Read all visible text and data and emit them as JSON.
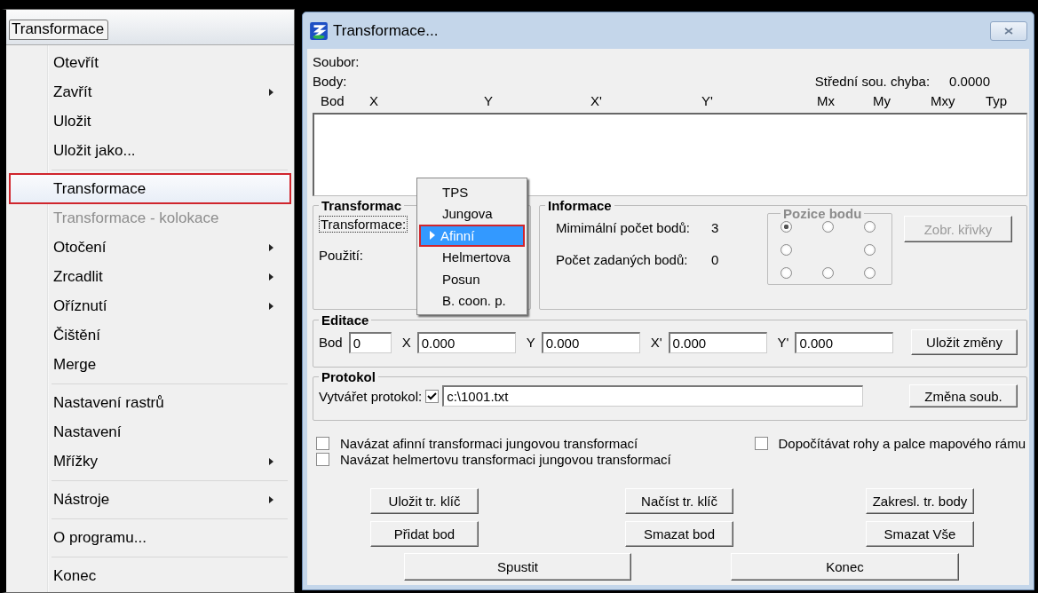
{
  "menu_bar": {
    "title": "Transformace"
  },
  "menu": {
    "groups": [
      [
        {
          "label": "Otevřít",
          "submenu": false,
          "disabled": false,
          "selected": false
        },
        {
          "label": "Zavřít",
          "submenu": true,
          "disabled": false,
          "selected": false
        },
        {
          "label": "Uložit",
          "submenu": false,
          "disabled": false,
          "selected": false
        },
        {
          "label": "Uložit jako...",
          "submenu": false,
          "disabled": false,
          "selected": false
        }
      ],
      [
        {
          "label": "Transformace",
          "submenu": false,
          "disabled": false,
          "selected": true
        },
        {
          "label": "Transformace - kolokace",
          "submenu": false,
          "disabled": true,
          "selected": false
        },
        {
          "label": "Otočení",
          "submenu": true,
          "disabled": false,
          "selected": false
        },
        {
          "label": "Zrcadlit",
          "submenu": true,
          "disabled": false,
          "selected": false
        },
        {
          "label": "Oříznutí",
          "submenu": true,
          "disabled": false,
          "selected": false
        },
        {
          "label": "Čištění",
          "submenu": false,
          "disabled": false,
          "selected": false
        },
        {
          "label": "Merge",
          "submenu": false,
          "disabled": false,
          "selected": false
        }
      ],
      [
        {
          "label": "Nastavení rastrů",
          "submenu": false,
          "disabled": false,
          "selected": false
        },
        {
          "label": "Nastavení",
          "submenu": false,
          "disabled": false,
          "selected": false
        },
        {
          "label": "Mřížky",
          "submenu": true,
          "disabled": false,
          "selected": false
        }
      ],
      [
        {
          "label": "Nástroje",
          "submenu": true,
          "disabled": false,
          "selected": false
        }
      ],
      [
        {
          "label": "O programu...",
          "submenu": false,
          "disabled": false,
          "selected": false
        }
      ],
      [
        {
          "label": "Konec",
          "submenu": false,
          "disabled": false,
          "selected": false
        }
      ]
    ]
  },
  "dialog": {
    "title": "Transformace...",
    "file_label": "Soubor:",
    "points_label": "Body:",
    "error_label": "Střední sou. chyba:",
    "error_value": "0.0000",
    "columns": [
      "Bod",
      "X",
      "Y",
      "X'",
      "Y'",
      "Mx",
      "My",
      "Mxy",
      "Typ"
    ],
    "transform_group": {
      "title": "Transformac",
      "transform_label": "Transformace:",
      "usage_label": "Použití:"
    },
    "dropdown": {
      "items": [
        {
          "label": "TPS",
          "selected": false
        },
        {
          "label": "Jungova",
          "selected": false
        },
        {
          "label": "Afinní",
          "selected": true
        },
        {
          "label": "Helmertova",
          "selected": false
        },
        {
          "label": "Posun",
          "selected": false
        },
        {
          "label": "B. coon. p.",
          "selected": false
        }
      ]
    },
    "info_group": {
      "title": "Informace",
      "rows": [
        {
          "label": "Mimimální počet bodů:",
          "value": "3"
        },
        {
          "label": "Počet zadaných bodů:",
          "value": "0"
        }
      ],
      "position_group": {
        "title": "Pozice bodu",
        "disabled": true,
        "radios": [
          {
            "selected": true
          },
          {
            "selected": false
          },
          {
            "selected": false
          },
          {
            "selected": false
          },
          {
            "selected": false
          },
          {
            "selected": false
          },
          {
            "selected": false
          },
          {
            "selected": false
          }
        ]
      },
      "curve_button": {
        "label": "Zobr. křivky",
        "disabled": true
      }
    },
    "edit_group": {
      "title": "Editace",
      "fields": [
        {
          "label": "Bod",
          "value": "0"
        },
        {
          "label": "X",
          "value": "0.000"
        },
        {
          "label": "Y",
          "value": "0.000"
        },
        {
          "label": "X'",
          "value": "0.000"
        },
        {
          "label": "Y'",
          "value": "0.000"
        }
      ],
      "save_button": "Uložit změny"
    },
    "protocol_group": {
      "title": "Protokol",
      "checkbox_label": "Vytvářet protokol:",
      "checked": true,
      "path": "c:\\1001.txt",
      "change_button": "Změna soub."
    },
    "options_left": [
      {
        "label": "Navázat afinní transformaci jungovou transformací",
        "checked": false
      },
      {
        "label": "Navázat helmertovu transformaci jungovou transformací",
        "checked": false
      }
    ],
    "options_right": [
      {
        "label": "Dopočítávat rohy a palce mapového rámu",
        "checked": false
      }
    ],
    "button_rows": [
      [
        "Uložit tr. klíč",
        "Načíst tr. klíč",
        "Zakresl. tr. body"
      ],
      [
        "Přidat bod",
        "Smazat bod",
        "Smazat Vše"
      ],
      [
        "Spustit",
        "Konec"
      ]
    ]
  }
}
